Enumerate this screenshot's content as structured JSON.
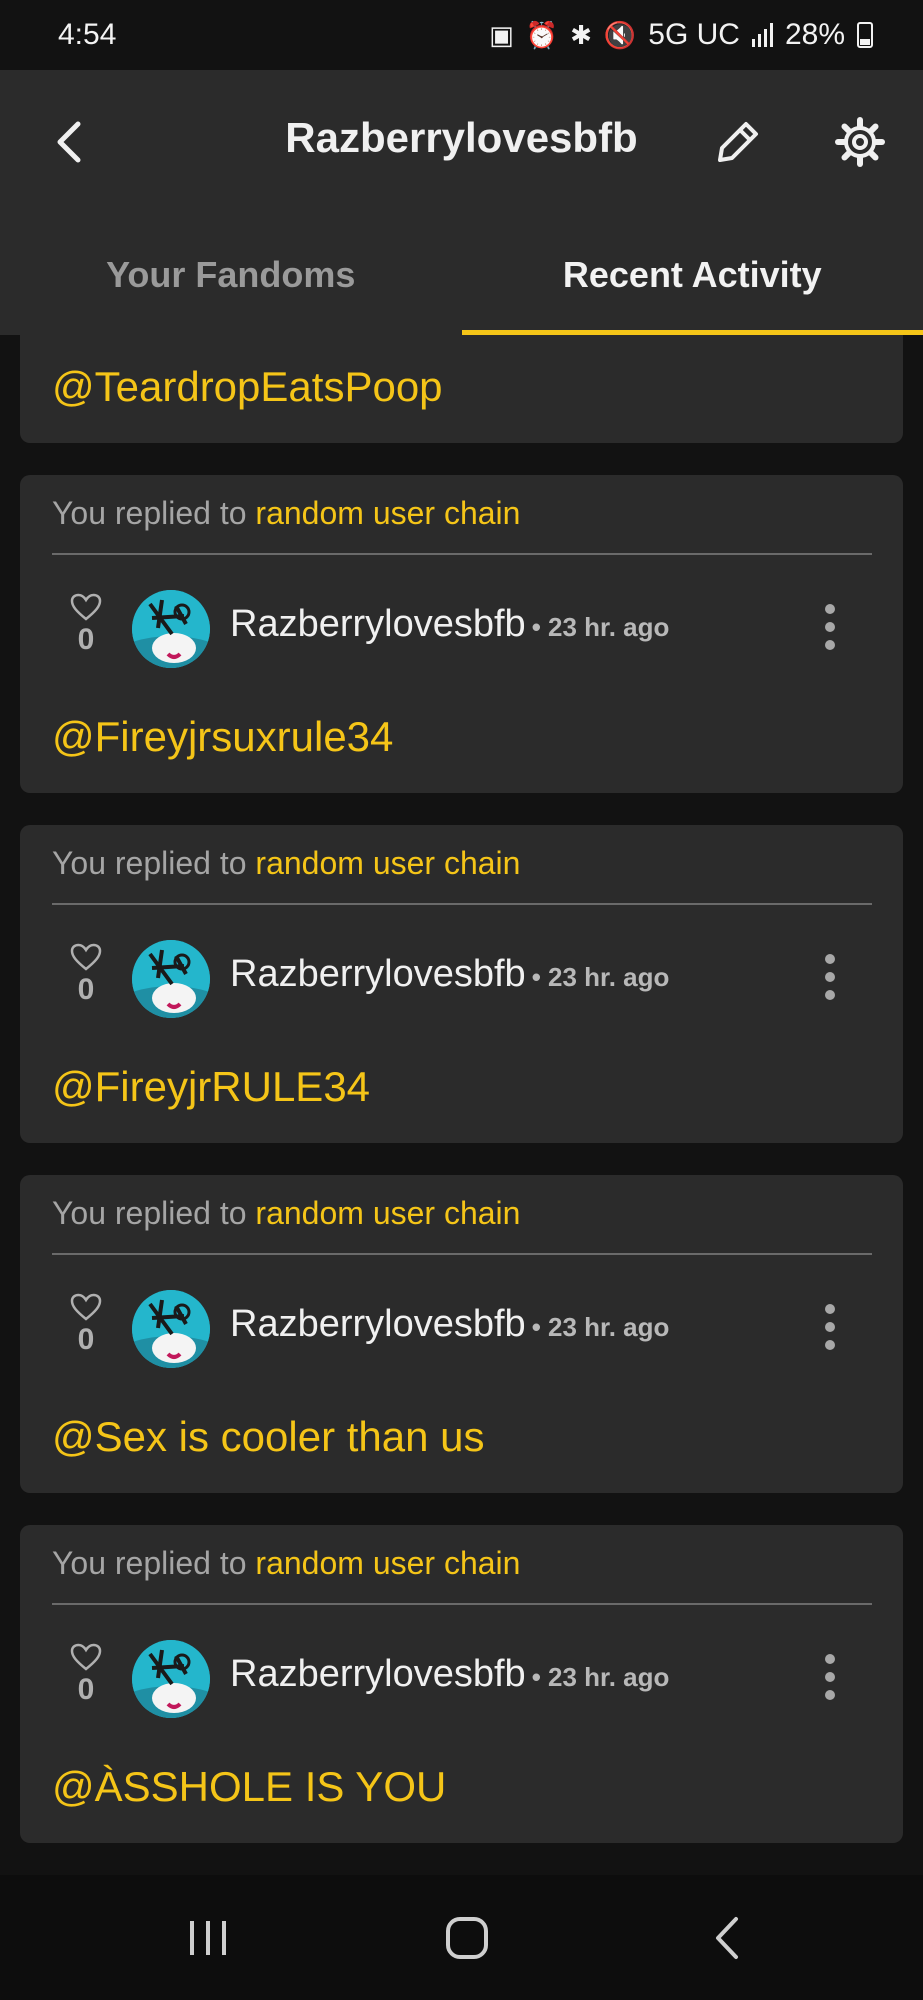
{
  "status": {
    "time": "4:54",
    "network": "5G UC",
    "battery": "28%"
  },
  "header": {
    "title": "Razberrylovesbfb"
  },
  "tabs": [
    {
      "label": "Your Fandoms",
      "active": false
    },
    {
      "label": "Recent Activity",
      "active": true
    }
  ],
  "partial_card": {
    "text": "@TeardropEatsPoop"
  },
  "cards": [
    {
      "replied_prefix": "You replied to",
      "replied_link": "random user chain",
      "likes": "0",
      "username": "Razberrylovesbfb",
      "time": "• 23 hr. ago",
      "message": "@Fireyjrsuxrule34"
    },
    {
      "replied_prefix": "You replied to",
      "replied_link": "random user chain",
      "likes": "0",
      "username": "Razberrylovesbfb",
      "time": "• 23 hr. ago",
      "message": "@FireyjrRULE34"
    },
    {
      "replied_prefix": "You replied to",
      "replied_link": "random user chain",
      "likes": "0",
      "username": "Razberrylovesbfb",
      "time": "• 23 hr. ago",
      "message": "@Sex is cooler than us"
    },
    {
      "replied_prefix": "You replied to",
      "replied_link": "random user chain",
      "likes": "0",
      "username": "Razberrylovesbfb",
      "time": "• 23 hr. ago",
      "message": "@ÀSSHOLE IS YOU"
    }
  ],
  "colors": {
    "accent": "#f5c518",
    "card": "#2b2b2b",
    "background": "#121212"
  },
  "icons": {
    "status": [
      "sim-icon",
      "alarm-icon",
      "bluetooth-icon",
      "mute-icon",
      "signal-icon",
      "battery-icon"
    ],
    "header": [
      "back-icon",
      "edit-icon",
      "settings-icon"
    ],
    "nav": [
      "recents-icon",
      "home-icon",
      "nav-back-icon"
    ]
  }
}
